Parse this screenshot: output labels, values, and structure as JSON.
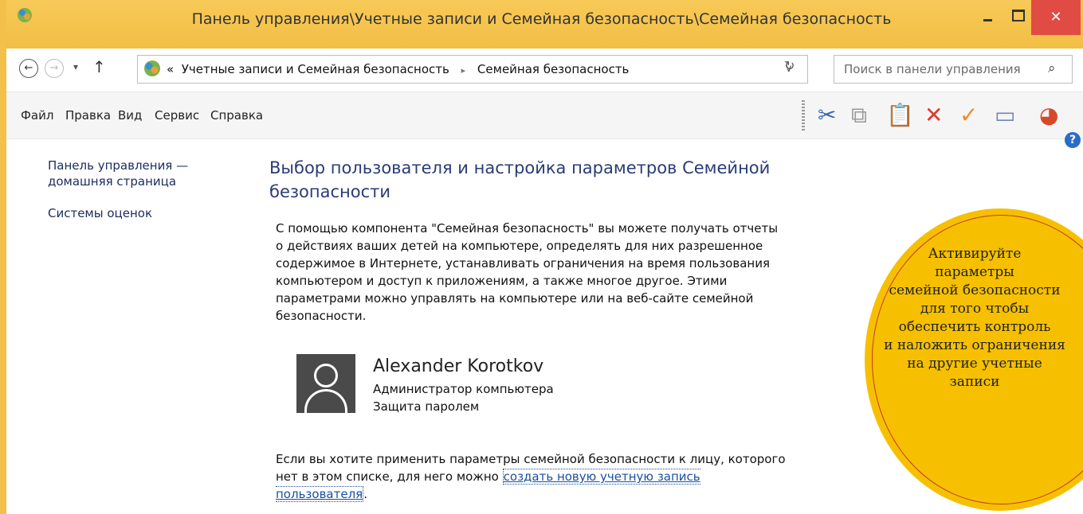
{
  "window": {
    "title": "Панель управления\\Учетные записи и Семейная безопасность\\Семейная безопасность",
    "close_glyph": "✕"
  },
  "navigation": {
    "back_glyph": "←",
    "forward_glyph": "→",
    "recent_glyph": "▾",
    "up_glyph": "↑",
    "address_prefix": "«",
    "breadcrumb": [
      "Учетные записи и Семейная безопасность",
      "Семейная безопасность"
    ],
    "breadcrumb_separator": "▸",
    "address_dropdown_glyph": "∨",
    "refresh_glyph": "↻",
    "search_placeholder": "Поиск в панели управления",
    "search_glyph": "⌕"
  },
  "menu": {
    "items": [
      "Файл",
      "Правка",
      "Вид",
      "Сервис",
      "Справка"
    ]
  },
  "toolbar": {
    "icons": [
      "scissors-icon",
      "copy-icon",
      "paste-icon",
      "delete-icon",
      "check-icon",
      "properties-icon",
      "color-wheel-icon"
    ],
    "glyphs": [
      "✂",
      "⧉",
      "📋",
      "✕",
      "✓",
      "▭",
      "◕"
    ],
    "colors": {
      "scissors": "#3b66b0",
      "delete": "#e03a2f",
      "check": "#f08b2c",
      "accent": "#2a3b78"
    }
  },
  "help_glyph": "?",
  "sidebar": {
    "items": [
      "Панель управления — домашняя страница",
      "Системы оценок"
    ]
  },
  "main": {
    "heading": "Выбор пользователя и настройка параметров Семейной безопасности",
    "description": "С помощью компонента \"Семейная безопасность\" вы можете получать отчеты о действиях ваших детей на компьютере, определять для них разрешенное содержимое в Интернете, устанавливать ограничения на время пользования компьютером и доступ к приложениям, а также многое другое. Этими параметрами можно управлять на компьютере или на веб-сайте семейной безопасности.",
    "user": {
      "name": "Alexander Korotkov",
      "role": "Администратор компьютера",
      "protection": "Защита паролем"
    },
    "footer_text": "Если вы хотите применить параметры семейной безопасности к лицу, которого нет в этом списке, для него можно",
    "footer_link": "создать новую учетную запись пользователя",
    "footer_end": "."
  },
  "callout": {
    "lines": [
      "Активируйте",
      "параметры",
      "семейной безопасности",
      "для того чтобы",
      "обеспечить контроль",
      "и наложить ограничения",
      "на другие учетные",
      "записи"
    ]
  }
}
